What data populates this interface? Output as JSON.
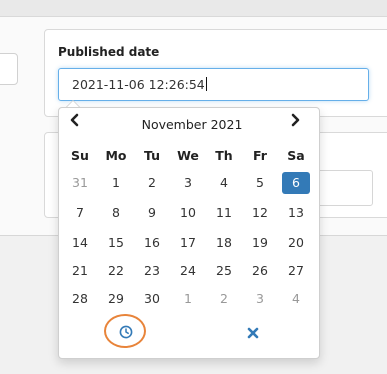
{
  "form": {
    "published_label": "Published date",
    "published_value": "2021-11-06 12:26:54"
  },
  "datepicker": {
    "month_title": "November 2021",
    "prev_label": "‹",
    "next_label": "›",
    "weekdays": [
      "Su",
      "Mo",
      "Tu",
      "We",
      "Th",
      "Fr",
      "Sa"
    ],
    "weeks": [
      [
        "31",
        "1",
        "2",
        "3",
        "4",
        "5",
        "6"
      ],
      [
        "7",
        "8",
        "9",
        "10",
        "11",
        "12",
        "13"
      ],
      [
        "14",
        "15",
        "16",
        "17",
        "18",
        "19",
        "20"
      ],
      [
        "21",
        "22",
        "23",
        "24",
        "25",
        "26",
        "27"
      ],
      [
        "28",
        "29",
        "30",
        "1",
        "2",
        "3",
        "4"
      ]
    ],
    "selected_day": "6",
    "icons": {
      "time": "clock-icon",
      "clear": "close-icon"
    },
    "colors": {
      "selected_bg": "#337ab7",
      "highlight_ring": "#e8843a",
      "clear_icon": "#337ab7"
    }
  }
}
